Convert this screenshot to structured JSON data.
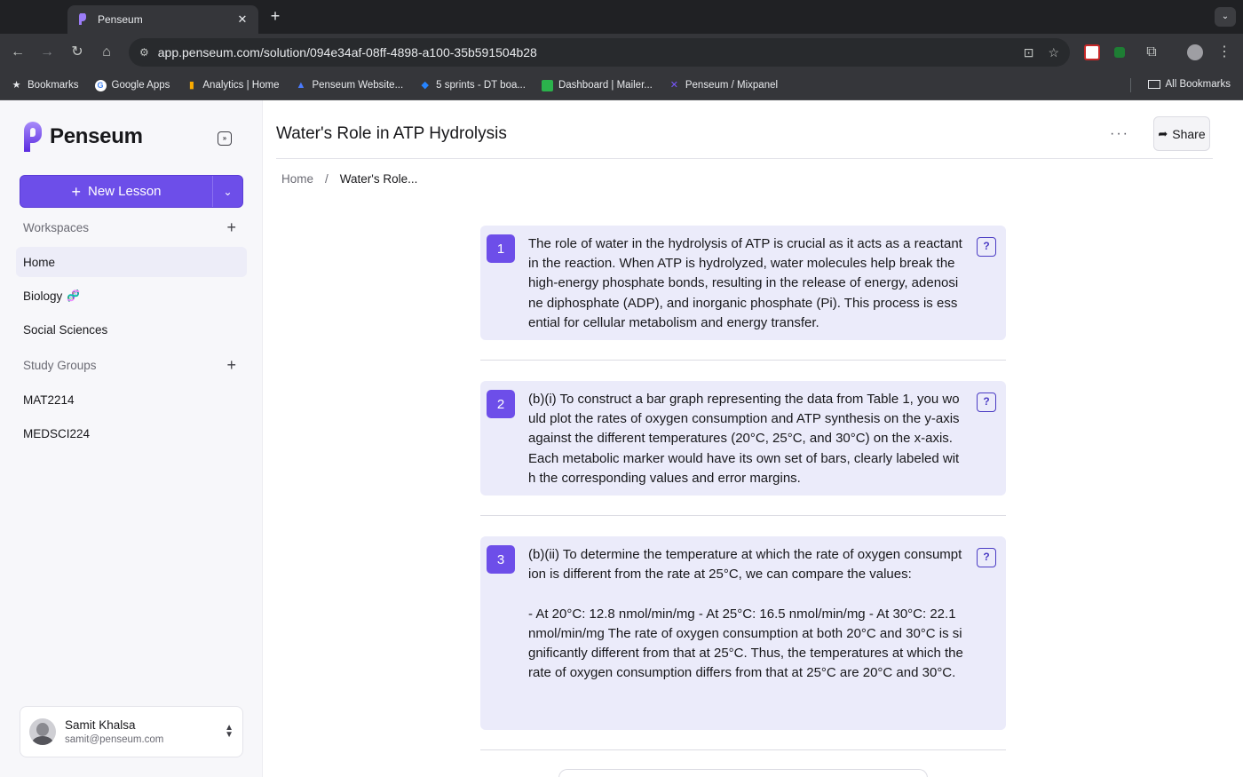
{
  "browser": {
    "tab_title": "Penseum",
    "url": "app.penseum.com/solution/094e34af-08ff-4898-a100-35b591504b28",
    "bookmarks": [
      {
        "label": "Bookmarks",
        "icon": "star-icon"
      },
      {
        "label": "Google Apps",
        "icon": "google-icon"
      },
      {
        "label": "Analytics | Home",
        "icon": "analytics-icon"
      },
      {
        "label": "Penseum Website...",
        "icon": "penseum-site-icon"
      },
      {
        "label": "5 sprints - DT boa...",
        "icon": "jira-icon"
      },
      {
        "label": "Dashboard | Mailer...",
        "icon": "mailer-icon"
      },
      {
        "label": "Penseum / Mixpanel",
        "icon": "mixpanel-icon"
      }
    ],
    "all_bookmarks": "All Bookmarks"
  },
  "sidebar": {
    "brand": "Penseum",
    "new_lesson": "New Lesson",
    "workspaces_label": "Workspaces",
    "workspaces": [
      "Home",
      "Biology",
      "Social Sciences"
    ],
    "study_groups_label": "Study Groups",
    "study_groups": [
      "MAT2214",
      "MEDSCI224"
    ],
    "user": {
      "name": "Samit Khalsa",
      "email": "samit@penseum.com"
    }
  },
  "main": {
    "title": "Water's Role in ATP Hydrolysis",
    "share": "Share",
    "breadcrumb": {
      "home": "Home",
      "sep": "/",
      "current": "Water's Role..."
    },
    "cards": [
      {
        "number": "1",
        "text": "The role of water in the hydrolysis of ATP is crucial as it acts as a reactant in the reaction. When ATP is hydrolyzed, water molecules help break the high-energy phosphate bonds, resulting in the release of energy, adenosine diphosphate (ADP), and inorganic phosphate (Pi). This process is essential for cellular metabolism and energy transfer."
      },
      {
        "number": "2",
        "text": "(b)(i) To construct a bar graph representing the data from Table 1, you would plot the rates of oxygen consumption and ATP synthesis on the y-axis against the different temperatures (20°C, 25°C, and 30°C) on the x-axis. Each metabolic marker would have its own set of bars, clearly labeled with the corresponding values and error margins."
      },
      {
        "number": "3",
        "text": "(b)(ii) To determine the temperature at which the rate of oxygen consumption is different from the rate at 25°C, we can compare the values:\n\n- At 20°C: 12.8 nmol/min/mg - At 25°C: 16.5 nmol/min/mg - At 30°C: 22.1 nmol/min/mg The rate of oxygen consumption at both 20°C and 30°C is significantly different from that at 25°C. Thus, the temperatures at which the rate of oxygen consumption differs from that at 25°C are 20°C and 30°C."
      }
    ]
  },
  "colors": {
    "accent": "#6d4ee9",
    "card_bg": "#ebebfa",
    "sidebar_bg": "#f7f7fa"
  }
}
